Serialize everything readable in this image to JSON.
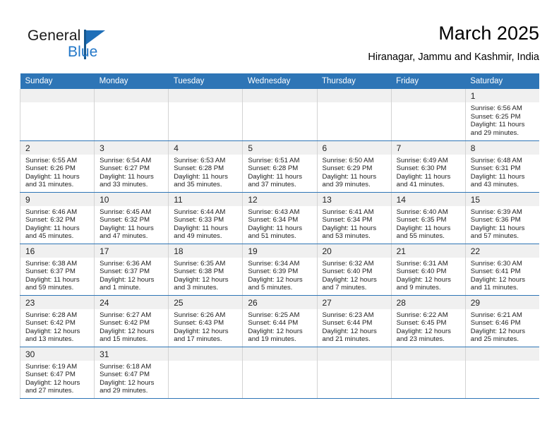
{
  "brand": {
    "name_part1": "General",
    "name_part2": "Blue",
    "flag_icon": "triangle-flag-icon"
  },
  "header": {
    "title": "March 2025",
    "subtitle": "Hiranagar, Jammu and Kashmir, India"
  },
  "colors": {
    "header_blue": "#2e75b6",
    "brand_blue": "#2277c8",
    "daynum_band": "#f0f0f0",
    "cell_divider": "#d3d3d3"
  },
  "calendar": {
    "weekday_headers": [
      "Sunday",
      "Monday",
      "Tuesday",
      "Wednesday",
      "Thursday",
      "Friday",
      "Saturday"
    ],
    "weeks": [
      [
        {
          "day": "",
          "empty": true
        },
        {
          "day": "",
          "empty": true
        },
        {
          "day": "",
          "empty": true
        },
        {
          "day": "",
          "empty": true
        },
        {
          "day": "",
          "empty": true
        },
        {
          "day": "",
          "empty": true
        },
        {
          "day": "1",
          "sunrise": "Sunrise: 6:56 AM",
          "sunset": "Sunset: 6:25 PM",
          "daylight": "Daylight: 11 hours and 29 minutes."
        }
      ],
      [
        {
          "day": "2",
          "sunrise": "Sunrise: 6:55 AM",
          "sunset": "Sunset: 6:26 PM",
          "daylight": "Daylight: 11 hours and 31 minutes."
        },
        {
          "day": "3",
          "sunrise": "Sunrise: 6:54 AM",
          "sunset": "Sunset: 6:27 PM",
          "daylight": "Daylight: 11 hours and 33 minutes."
        },
        {
          "day": "4",
          "sunrise": "Sunrise: 6:53 AM",
          "sunset": "Sunset: 6:28 PM",
          "daylight": "Daylight: 11 hours and 35 minutes."
        },
        {
          "day": "5",
          "sunrise": "Sunrise: 6:51 AM",
          "sunset": "Sunset: 6:28 PM",
          "daylight": "Daylight: 11 hours and 37 minutes."
        },
        {
          "day": "6",
          "sunrise": "Sunrise: 6:50 AM",
          "sunset": "Sunset: 6:29 PM",
          "daylight": "Daylight: 11 hours and 39 minutes."
        },
        {
          "day": "7",
          "sunrise": "Sunrise: 6:49 AM",
          "sunset": "Sunset: 6:30 PM",
          "daylight": "Daylight: 11 hours and 41 minutes."
        },
        {
          "day": "8",
          "sunrise": "Sunrise: 6:48 AM",
          "sunset": "Sunset: 6:31 PM",
          "daylight": "Daylight: 11 hours and 43 minutes."
        }
      ],
      [
        {
          "day": "9",
          "sunrise": "Sunrise: 6:46 AM",
          "sunset": "Sunset: 6:32 PM",
          "daylight": "Daylight: 11 hours and 45 minutes."
        },
        {
          "day": "10",
          "sunrise": "Sunrise: 6:45 AM",
          "sunset": "Sunset: 6:32 PM",
          "daylight": "Daylight: 11 hours and 47 minutes."
        },
        {
          "day": "11",
          "sunrise": "Sunrise: 6:44 AM",
          "sunset": "Sunset: 6:33 PM",
          "daylight": "Daylight: 11 hours and 49 minutes."
        },
        {
          "day": "12",
          "sunrise": "Sunrise: 6:43 AM",
          "sunset": "Sunset: 6:34 PM",
          "daylight": "Daylight: 11 hours and 51 minutes."
        },
        {
          "day": "13",
          "sunrise": "Sunrise: 6:41 AM",
          "sunset": "Sunset: 6:34 PM",
          "daylight": "Daylight: 11 hours and 53 minutes."
        },
        {
          "day": "14",
          "sunrise": "Sunrise: 6:40 AM",
          "sunset": "Sunset: 6:35 PM",
          "daylight": "Daylight: 11 hours and 55 minutes."
        },
        {
          "day": "15",
          "sunrise": "Sunrise: 6:39 AM",
          "sunset": "Sunset: 6:36 PM",
          "daylight": "Daylight: 11 hours and 57 minutes."
        }
      ],
      [
        {
          "day": "16",
          "sunrise": "Sunrise: 6:38 AM",
          "sunset": "Sunset: 6:37 PM",
          "daylight": "Daylight: 11 hours and 59 minutes."
        },
        {
          "day": "17",
          "sunrise": "Sunrise: 6:36 AM",
          "sunset": "Sunset: 6:37 PM",
          "daylight": "Daylight: 12 hours and 1 minute."
        },
        {
          "day": "18",
          "sunrise": "Sunrise: 6:35 AM",
          "sunset": "Sunset: 6:38 PM",
          "daylight": "Daylight: 12 hours and 3 minutes."
        },
        {
          "day": "19",
          "sunrise": "Sunrise: 6:34 AM",
          "sunset": "Sunset: 6:39 PM",
          "daylight": "Daylight: 12 hours and 5 minutes."
        },
        {
          "day": "20",
          "sunrise": "Sunrise: 6:32 AM",
          "sunset": "Sunset: 6:40 PM",
          "daylight": "Daylight: 12 hours and 7 minutes."
        },
        {
          "day": "21",
          "sunrise": "Sunrise: 6:31 AM",
          "sunset": "Sunset: 6:40 PM",
          "daylight": "Daylight: 12 hours and 9 minutes."
        },
        {
          "day": "22",
          "sunrise": "Sunrise: 6:30 AM",
          "sunset": "Sunset: 6:41 PM",
          "daylight": "Daylight: 12 hours and 11 minutes."
        }
      ],
      [
        {
          "day": "23",
          "sunrise": "Sunrise: 6:28 AM",
          "sunset": "Sunset: 6:42 PM",
          "daylight": "Daylight: 12 hours and 13 minutes."
        },
        {
          "day": "24",
          "sunrise": "Sunrise: 6:27 AM",
          "sunset": "Sunset: 6:42 PM",
          "daylight": "Daylight: 12 hours and 15 minutes."
        },
        {
          "day": "25",
          "sunrise": "Sunrise: 6:26 AM",
          "sunset": "Sunset: 6:43 PM",
          "daylight": "Daylight: 12 hours and 17 minutes."
        },
        {
          "day": "26",
          "sunrise": "Sunrise: 6:25 AM",
          "sunset": "Sunset: 6:44 PM",
          "daylight": "Daylight: 12 hours and 19 minutes."
        },
        {
          "day": "27",
          "sunrise": "Sunrise: 6:23 AM",
          "sunset": "Sunset: 6:44 PM",
          "daylight": "Daylight: 12 hours and 21 minutes."
        },
        {
          "day": "28",
          "sunrise": "Sunrise: 6:22 AM",
          "sunset": "Sunset: 6:45 PM",
          "daylight": "Daylight: 12 hours and 23 minutes."
        },
        {
          "day": "29",
          "sunrise": "Sunrise: 6:21 AM",
          "sunset": "Sunset: 6:46 PM",
          "daylight": "Daylight: 12 hours and 25 minutes."
        }
      ],
      [
        {
          "day": "30",
          "sunrise": "Sunrise: 6:19 AM",
          "sunset": "Sunset: 6:47 PM",
          "daylight": "Daylight: 12 hours and 27 minutes."
        },
        {
          "day": "31",
          "sunrise": "Sunrise: 6:18 AM",
          "sunset": "Sunset: 6:47 PM",
          "daylight": "Daylight: 12 hours and 29 minutes."
        },
        {
          "day": "",
          "empty": true
        },
        {
          "day": "",
          "empty": true
        },
        {
          "day": "",
          "empty": true
        },
        {
          "day": "",
          "empty": true
        },
        {
          "day": "",
          "empty": true
        }
      ]
    ]
  }
}
